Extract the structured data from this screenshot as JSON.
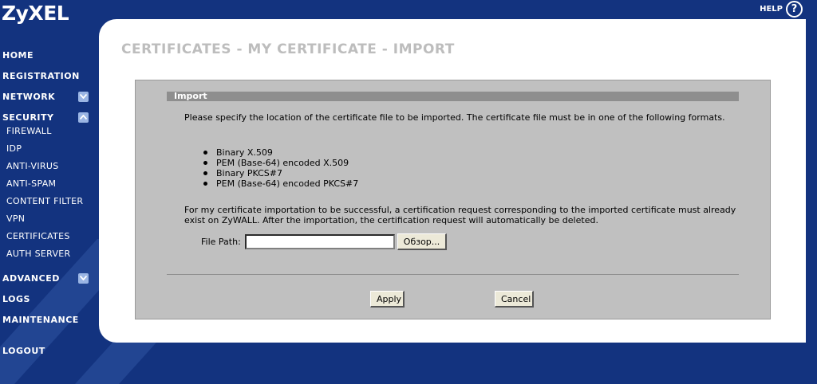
{
  "brand": {
    "logo": "ZyXEL"
  },
  "header": {
    "help_label": "HELP",
    "help_icon": "question-circle-icon"
  },
  "sidebar": {
    "items": [
      {
        "label": "HOME"
      },
      {
        "label": "REGISTRATION"
      },
      {
        "label": "NETWORK",
        "toggle": "expand"
      },
      {
        "label": "SECURITY",
        "toggle": "collapse"
      },
      {
        "label": "ADVANCED",
        "toggle": "expand"
      },
      {
        "label": "LOGS"
      },
      {
        "label": "MAINTENANCE"
      },
      {
        "label": "LOGOUT"
      }
    ],
    "security_subitems": [
      "FIREWALL",
      "IDP",
      "ANTI-VIRUS",
      "ANTI-SPAM",
      "CONTENT FILTER",
      "VPN",
      "CERTIFICATES",
      "AUTH SERVER"
    ]
  },
  "page": {
    "title": "CERTIFICATES - MY CERTIFICATE - IMPORT",
    "section_title": "Import",
    "description": "Please specify the location of the certificate file to be imported. The certificate file must be in one of the following formats.",
    "formats": [
      "Binary X.509",
      "PEM (Base-64) encoded X.509",
      "Binary PKCS#7",
      "PEM (Base-64) encoded PKCS#7"
    ],
    "note": "For my certificate importation to be successful, a certification request corresponding to the imported certificate must already exist on ZyWALL. After the importation, the certification request will automatically be deleted.",
    "file_path_label": "File Path:",
    "file_path_value": "",
    "browse_label": "Обзор...",
    "apply_label": "Apply",
    "cancel_label": "Cancel"
  },
  "colors": {
    "background": "#13337f",
    "panel": "#ffffff",
    "form_box": "#c0c0c0",
    "section_bar": "#8e8e8e",
    "title_text": "#bdbdbd"
  }
}
